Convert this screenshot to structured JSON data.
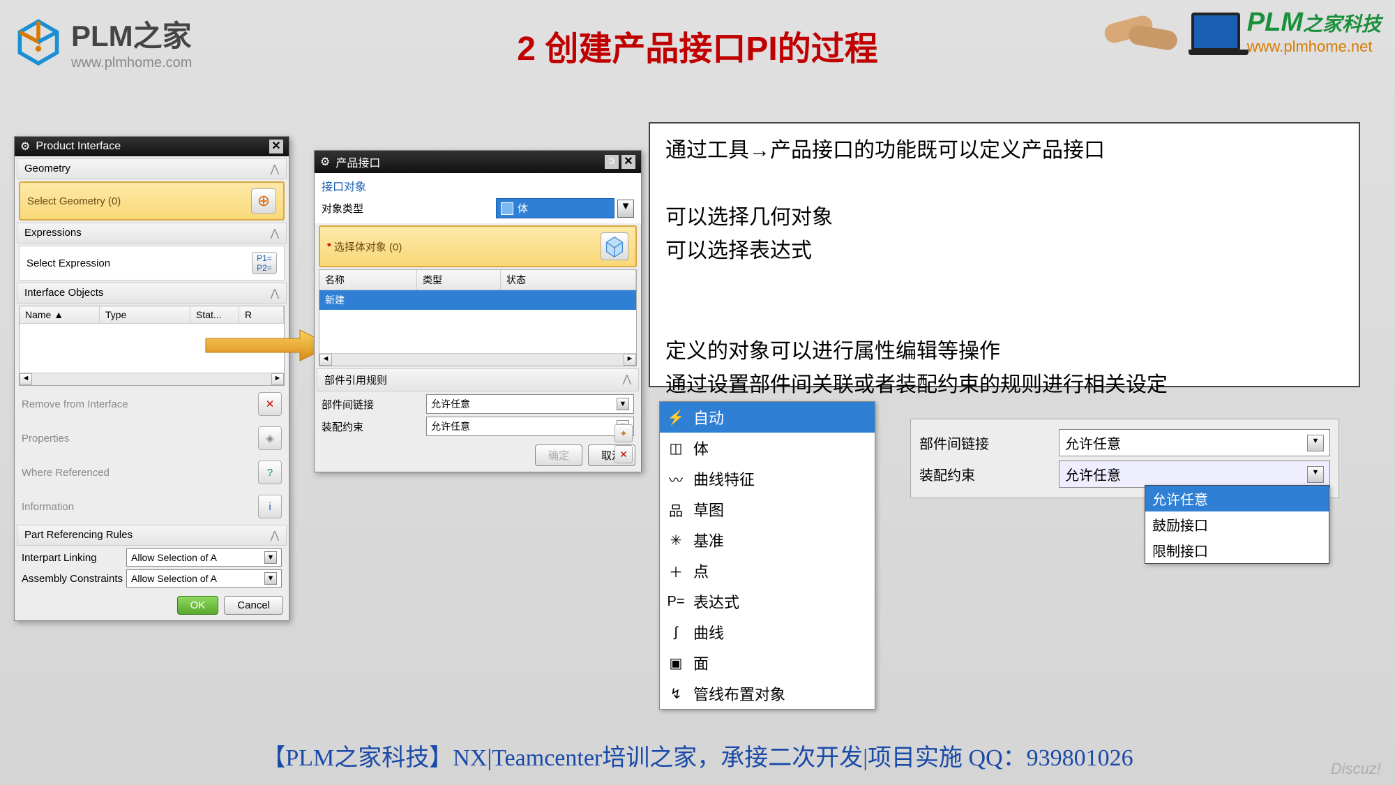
{
  "header": {
    "logo_text": "PLM之家",
    "logo_url": "www.plmhome.com",
    "title": "2 创建产品接口PI的过程",
    "right_logo_main": "PLM",
    "right_logo_sub": "之家科技",
    "right_url": "www.plmhome.net"
  },
  "dlg1": {
    "title": "Product Interface",
    "sec_geometry": "Geometry",
    "select_geometry": "Select Geometry (0)",
    "sec_expressions": "Expressions",
    "select_expression": "Select Expression",
    "sec_interface_objects": "Interface Objects",
    "col_name": "Name",
    "col_type": "Type",
    "col_stat": "Stat...",
    "col_r": "R",
    "remove": "Remove from Interface",
    "properties": "Properties",
    "where_ref": "Where Referenced",
    "information": "Information",
    "sec_rules": "Part Referencing Rules",
    "interpart": "Interpart Linking",
    "interpart_val": "Allow Selection of A",
    "assembly": "Assembly Constraints",
    "assembly_val": "Allow Selection of A",
    "ok": "OK",
    "cancel": "Cancel"
  },
  "dlg2": {
    "title": "产品接口",
    "sec_interface_obj": "接口对象",
    "obj_type_label": "对象类型",
    "obj_type_value": "体",
    "select_body": "选择体对象 (0)",
    "col_name": "名称",
    "col_type": "类型",
    "col_status": "状态",
    "row_new": "新建",
    "sec_rules": "部件引用规则",
    "interpart": "部件间链接",
    "interpart_val": "允许任意",
    "assembly": "装配约束",
    "assembly_val": "允许任意",
    "ok": "确定",
    "cancel": "取消"
  },
  "info": {
    "l1": "通过工具→产品接口的功能既可以定义产品接口",
    "l2": "可以选择几何对象",
    "l3": "可以选择表达式",
    "l4": "定义的对象可以进行属性编辑等操作",
    "l5": "通过设置部件间关联或者装配约束的规则进行相关设定"
  },
  "menu": {
    "items": [
      {
        "label": "自动",
        "icon": "⚡"
      },
      {
        "label": "体",
        "icon": "◫"
      },
      {
        "label": "曲线特征",
        "icon": "〰"
      },
      {
        "label": "草图",
        "icon": "品"
      },
      {
        "label": "基准",
        "icon": "✳"
      },
      {
        "label": "点",
        "icon": "＋"
      },
      {
        "label": "表达式",
        "icon": "P="
      },
      {
        "label": "曲线",
        "icon": "∫"
      },
      {
        "label": "面",
        "icon": "▣"
      },
      {
        "label": "管线布置对象",
        "icon": "↯"
      }
    ]
  },
  "rules_panel": {
    "interpart": "部件间链接",
    "interpart_val": "允许任意",
    "assembly": "装配约束",
    "assembly_val": "允许任意",
    "options": [
      "允许任意",
      "鼓励接口",
      "限制接口"
    ]
  },
  "footer": "【PLM之家科技】NX|Teamcenter培训之家，承接二次开发|项目实施 QQ：939801026",
  "discuz": "Discuz!"
}
